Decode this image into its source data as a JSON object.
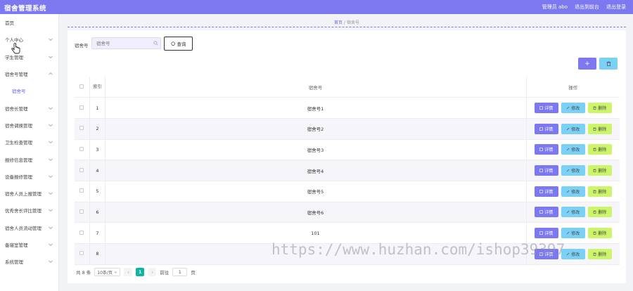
{
  "header": {
    "title": "宿舍管理系统",
    "user": "管理员 abo",
    "back": "退出到前台",
    "logout": "退出登录"
  },
  "sidebar": {
    "items": [
      {
        "label": "首页",
        "chevron": false,
        "sub": false
      },
      {
        "label": "个人中心",
        "chevron": true,
        "sub": false
      },
      {
        "label": "学生管理",
        "chevron": true,
        "sub": false
      },
      {
        "label": "宿舍号管理",
        "chevron": true,
        "sub": false,
        "open": true
      },
      {
        "label": "宿舍号",
        "chevron": false,
        "sub": true
      },
      {
        "label": "宿舍长管理",
        "chevron": true,
        "sub": false
      },
      {
        "label": "宿舍调换管理",
        "chevron": true,
        "sub": false
      },
      {
        "label": "卫生检查管理",
        "chevron": true,
        "sub": false
      },
      {
        "label": "报修信息管理",
        "chevron": true,
        "sub": false
      },
      {
        "label": "设备报修管理",
        "chevron": true,
        "sub": false
      },
      {
        "label": "宿舍人员上报管理",
        "chevron": true,
        "sub": false
      },
      {
        "label": "优秀舍长评比管理",
        "chevron": true,
        "sub": false
      },
      {
        "label": "宿舍人员流动管理",
        "chevron": true,
        "sub": false
      },
      {
        "label": "备寝室管理",
        "chevron": true,
        "sub": false
      },
      {
        "label": "系统管理",
        "chevron": true,
        "sub": false
      }
    ]
  },
  "breadcrumb": {
    "home": "首页",
    "sep": "/",
    "current": "宿舍号"
  },
  "search": {
    "label": "宿舍号",
    "placeholder": "宿舍号",
    "button": "查询"
  },
  "toolbar": {
    "add": "+",
    "delete": "🗑"
  },
  "table": {
    "headers": {
      "index": "索引",
      "name": "宿舍号",
      "ops": "操作"
    },
    "op_labels": {
      "detail": "详情",
      "edit": "修改",
      "remove": "删除"
    },
    "rows": [
      {
        "index": "1",
        "name": "宿舍号1"
      },
      {
        "index": "2",
        "name": "宿舍号2"
      },
      {
        "index": "3",
        "name": "宿舍号3"
      },
      {
        "index": "4",
        "name": "宿舍号4"
      },
      {
        "index": "5",
        "name": "宿舍号5"
      },
      {
        "index": "6",
        "name": "宿舍号6"
      },
      {
        "index": "7",
        "name": "101"
      },
      {
        "index": "8",
        "name": ""
      }
    ]
  },
  "pager": {
    "total": "共 8 条",
    "size": "10条/页",
    "current": "1",
    "goto": "前往",
    "goto_value": "1",
    "page_unit": "页"
  },
  "watermark": "https://www.huzhan.com/ishop39397"
}
